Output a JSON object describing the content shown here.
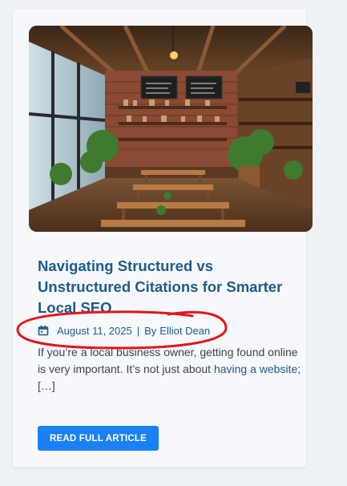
{
  "card": {
    "image": {
      "icon": "cafe-interior-photo",
      "board_text": "MENU"
    },
    "title": "Navigating Structured vs Unstructured Citations for Smarter Local SEO",
    "meta": {
      "date_icon": "calendar-icon",
      "date": "August 11, 2025",
      "separator": "|",
      "author_prefix": "By",
      "author": "Elliot Dean"
    },
    "excerpt": {
      "text_before_link": "If you’re a local business owner, getting found online is very important. It’s not just about ",
      "link_text": "having a website",
      "text_after_link": "; […]"
    },
    "button_label": "READ FULL ARTICLE"
  },
  "colors": {
    "title": "#1d5b8a",
    "button": "#1a80f3",
    "annotation": "#e0161b",
    "background": "#eef1f6",
    "card": "#f6f8fb"
  }
}
